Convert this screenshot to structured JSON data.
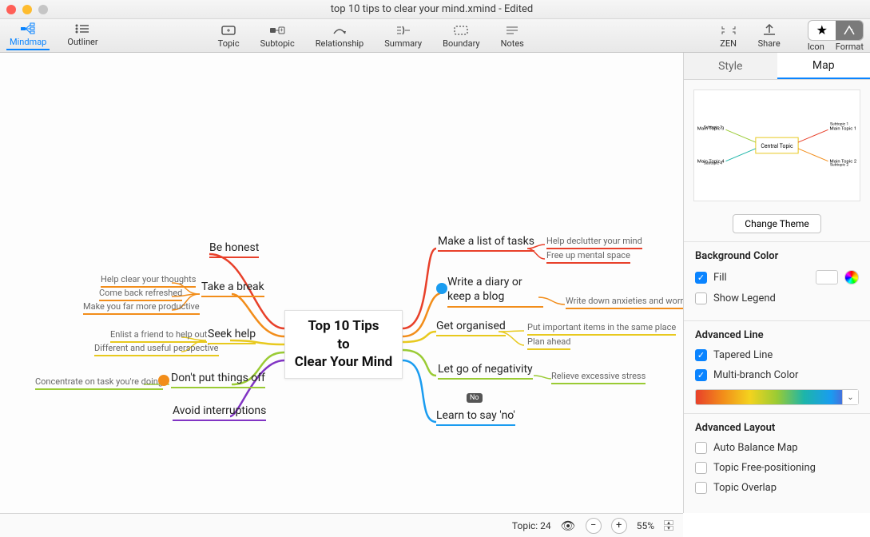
{
  "window": {
    "title": "top 10 tips to clear your mind.xmind - Edited"
  },
  "toolbar": {
    "mindmap": "Mindmap",
    "outliner": "Outliner",
    "topic": "Topic",
    "subtopic": "Subtopic",
    "relationship": "Relationship",
    "summary": "Summary",
    "boundary": "Boundary",
    "notes": "Notes",
    "zen": "ZEN",
    "share": "Share",
    "icon": "Icon",
    "format": "Format"
  },
  "panel": {
    "tab_style": "Style",
    "tab_map": "Map",
    "change_theme": "Change Theme",
    "bgcolor": "Background Color",
    "fill": "Fill",
    "showlegend": "Show Legend",
    "advline": "Advanced Line",
    "tapered": "Tapered Line",
    "multibranch": "Multi-branch Color",
    "advlayout": "Advanced Layout",
    "autobalance": "Auto Balance Map",
    "freepos": "Topic Free-positioning",
    "overlap": "Topic Overlap",
    "thumb": {
      "central": "Central Topic",
      "mt1": "Main Topic 1",
      "mt2": "Main Topic 2",
      "mt3": "Main Topic 3",
      "mt4": "Main Topic 4",
      "s1": "Subtopic 1",
      "s2": "Subtopic 2",
      "s3": "Subtopic 3",
      "s4": "Subtopic 4"
    }
  },
  "status": {
    "topic_label": "Topic:",
    "topic_count": "24",
    "zoom": "55%"
  },
  "mindmap": {
    "central": "Top 10 Tips\nto\nClear Your Mind",
    "left": {
      "behonest": "Be honest",
      "takebreak": "Take a break",
      "takebreak_subs": [
        "Help clear your thoughts",
        "Come back refreshed",
        "Make you far more productive"
      ],
      "seekhelp": "Seek help",
      "seekhelp_subs": [
        "Enlist a friend to help out",
        "Different and useful perspective"
      ],
      "dontput": "Don't put things off",
      "dontput_subs": [
        "Concentrate on task you're doing"
      ],
      "avoid": "Avoid interruptions"
    },
    "right": {
      "makelist": "Make a list of tasks",
      "makelist_subs": [
        "Help declutter your mind",
        "Free up mental space"
      ],
      "diary": "Write a diary or keep a blog",
      "diary_subs": [
        "Write down anxieties and worries"
      ],
      "organised": "Get organised",
      "organised_subs": [
        "Put important items in the same place",
        "Plan ahead"
      ],
      "letgo": "Let go of negativity",
      "letgo_subs": [
        "Relieve excessive stress"
      ],
      "sayno": "Learn to say 'no'",
      "sayno_tag": "No"
    }
  }
}
